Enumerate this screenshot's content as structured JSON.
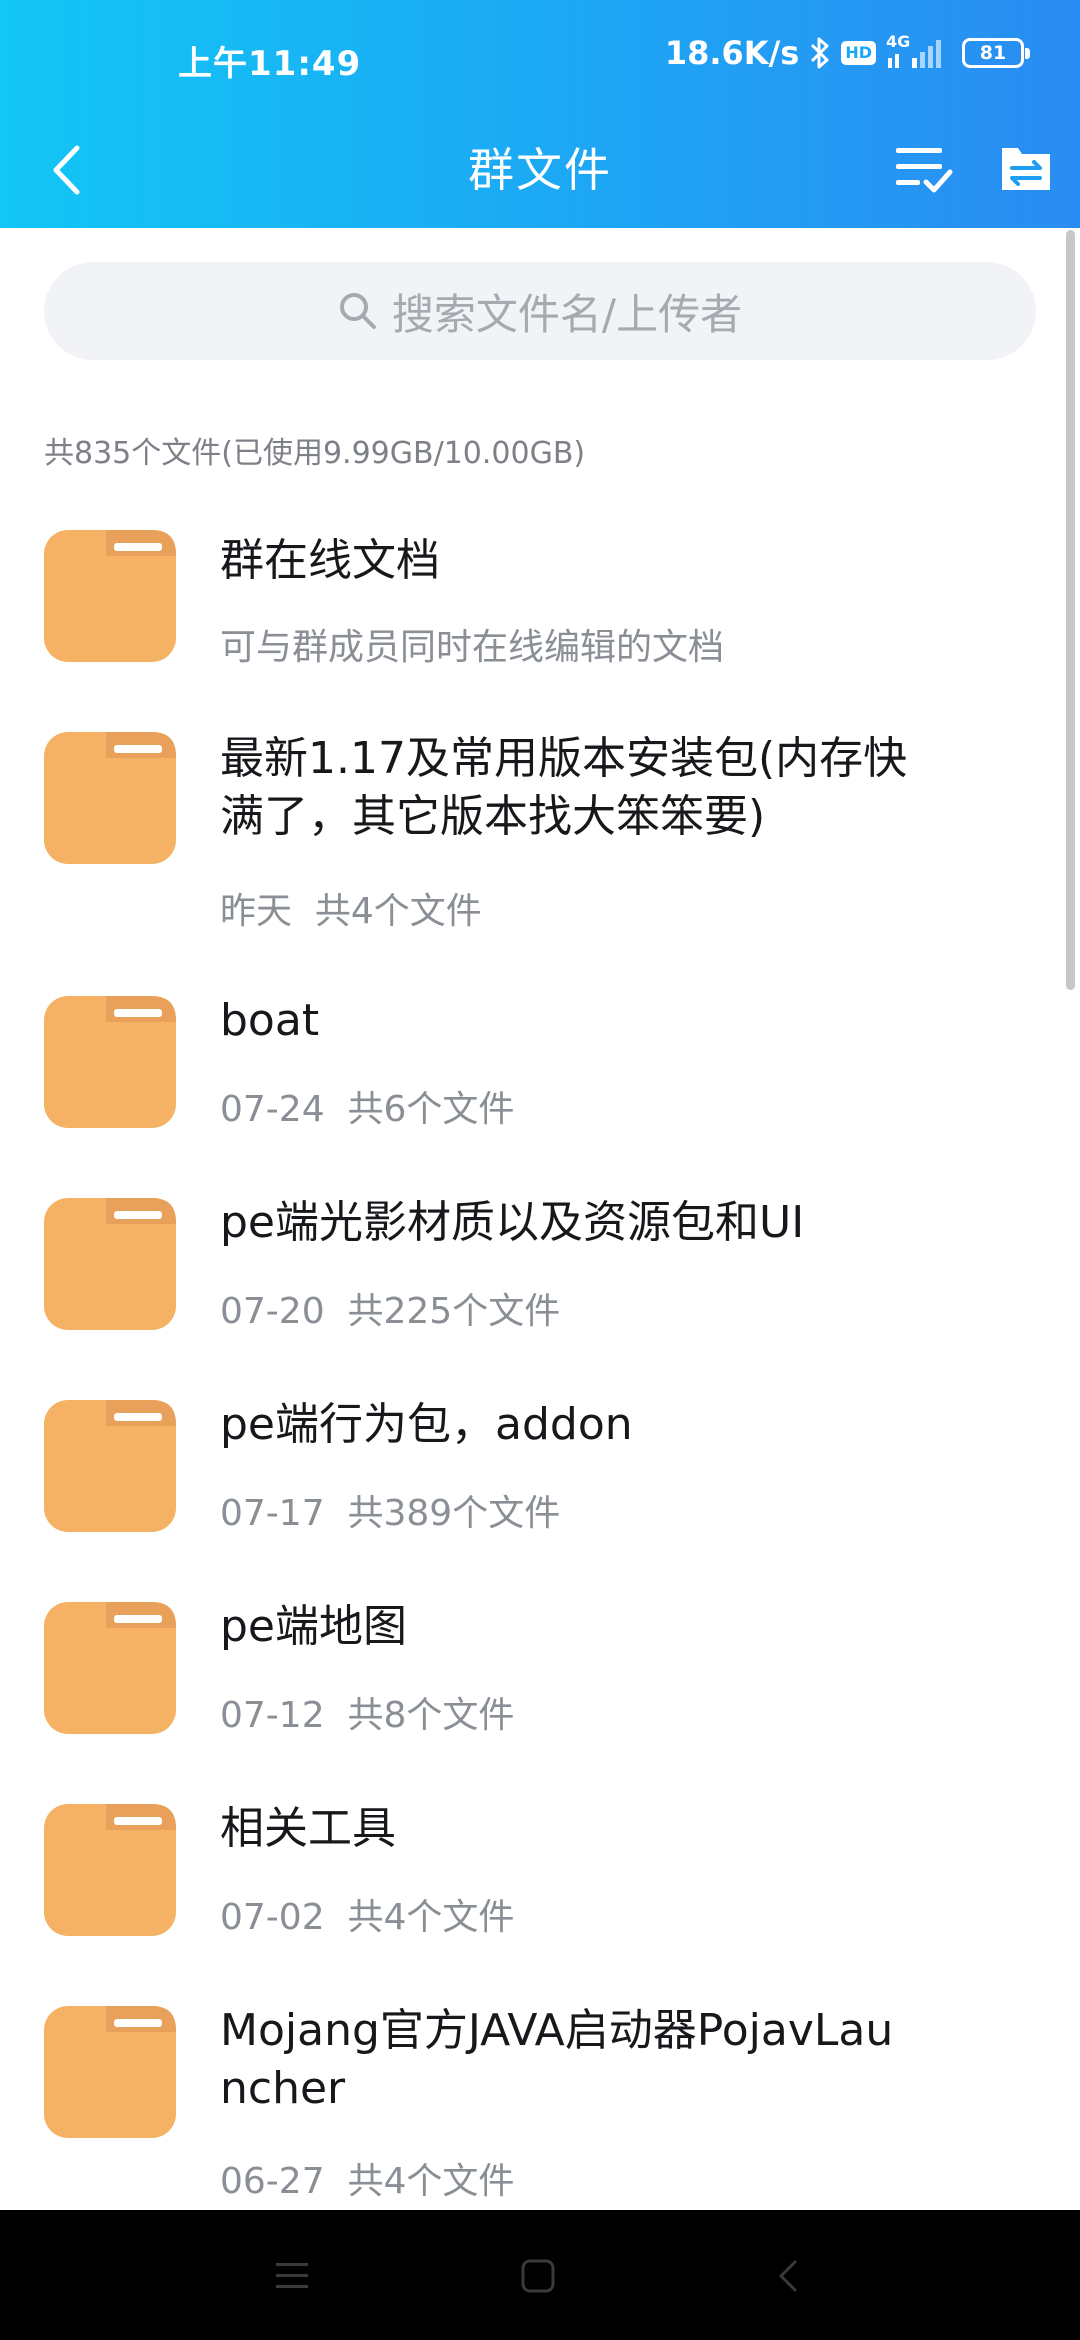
{
  "status_bar": {
    "time": "上午11:49",
    "network_speed": "18.6K/s",
    "hd_badge": "HD",
    "network_type": "4G",
    "battery": "81"
  },
  "nav": {
    "title": "群文件",
    "back_icon": "chevron-left-icon",
    "action_1_icon": "multi-select-icon",
    "action_2_icon": "transfer-icon"
  },
  "search": {
    "placeholder": "搜索文件名/上传者"
  },
  "summary": "共835个文件(已使用9.99GB/10.00GB)",
  "files": [
    {
      "name": "群在线文档",
      "meta": "可与群成员同时在线编辑的文档"
    },
    {
      "name": "最新1.17及常用版本安装包(内存快满了，其它版本找大笨笨要)",
      "meta": "昨天  共4个文件"
    },
    {
      "name": "boat",
      "meta": "07-24  共6个文件"
    },
    {
      "name": "pe端光影材质以及资源包和UI",
      "meta": "07-20  共225个文件"
    },
    {
      "name": "pe端行为包，addon",
      "meta": "07-17  共389个文件"
    },
    {
      "name": "pe端地图",
      "meta": "07-12  共8个文件"
    },
    {
      "name": "相关工具",
      "meta": "07-02  共4个文件"
    },
    {
      "name": "Mojang官方JAVA启动器PojavLauncher",
      "meta": "06-27  共4个文件"
    }
  ],
  "colors": {
    "header_start": "#12c6f5",
    "header_end": "#2a8cf2",
    "folder": "#f5b265",
    "folder_tab": "#e9a05a"
  }
}
